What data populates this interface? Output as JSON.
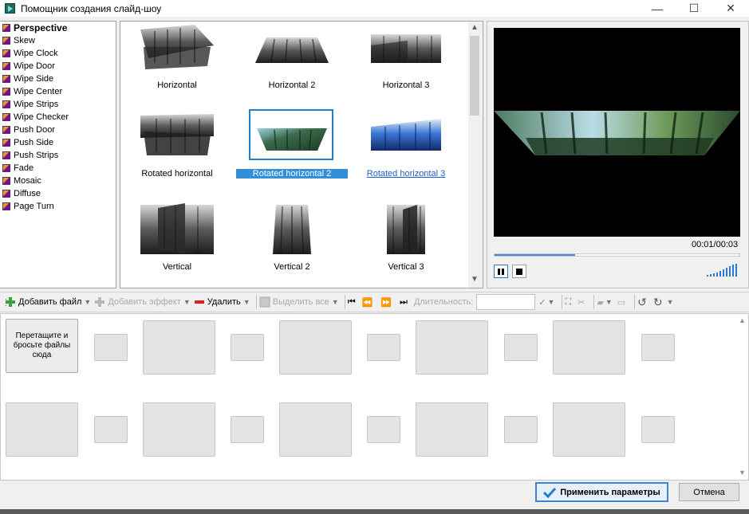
{
  "window": {
    "title": "Помощник создания слайд-шоу",
    "minimize": "—",
    "maximize": "☐",
    "close": "✕"
  },
  "effects": [
    {
      "label": "Perspective",
      "selected": true
    },
    {
      "label": "Skew"
    },
    {
      "label": "Wipe Clock"
    },
    {
      "label": "Wipe Door"
    },
    {
      "label": "Wipe Side"
    },
    {
      "label": "Wipe Center"
    },
    {
      "label": "Wipe Strips"
    },
    {
      "label": "Wipe Checker"
    },
    {
      "label": "Push Door"
    },
    {
      "label": "Push Side"
    },
    {
      "label": "Push Strips"
    },
    {
      "label": "Fade"
    },
    {
      "label": "Mosaic"
    },
    {
      "label": "Diffuse"
    },
    {
      "label": "Page Turn"
    }
  ],
  "gallery": {
    "items": [
      {
        "caption": "Horizontal"
      },
      {
        "caption": "Horizontal 2"
      },
      {
        "caption": "Horizontal 3"
      },
      {
        "caption": "Rotated horizontal"
      },
      {
        "caption": "Rotated horizontal 2",
        "state": "selected"
      },
      {
        "caption": "Rotated horizontal 3",
        "state": "hover"
      },
      {
        "caption": "Vertical"
      },
      {
        "caption": "Vertical 2"
      },
      {
        "caption": "Vertical 3"
      }
    ]
  },
  "preview": {
    "timecode": "00:01/00:03",
    "progress": 0.33,
    "volume_icon": "volume-bars-icon"
  },
  "toolbar": {
    "add_file": "Добавить файл",
    "add_effect": "Добавить эффект",
    "delete": "Удалить",
    "select_all": "Выделить все",
    "duration_label": "Длительность:"
  },
  "storyboard": {
    "drop_hint": "Перетащите и бросьте файлы сюда"
  },
  "buttons": {
    "apply": "Применить параметры",
    "cancel": "Отмена"
  },
  "colors": {
    "accent": "#1f7fd0",
    "selection": "#3390d8",
    "link": "#1a60c8"
  }
}
